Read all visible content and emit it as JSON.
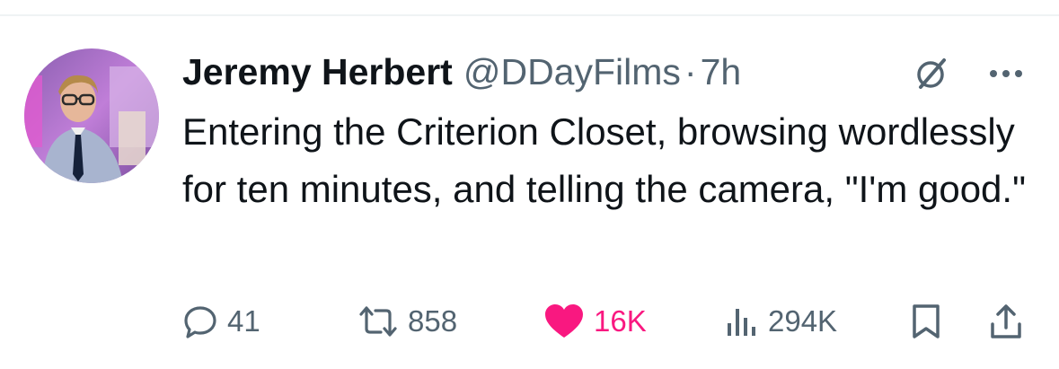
{
  "tweet": {
    "author": {
      "display_name": "Jeremy Herbert",
      "handle": "@DDayFilms"
    },
    "separator": "·",
    "time": "7h",
    "text": "Entering the Criterion Closet, browsing wordlessly for ten minutes, and telling the camera, \"I'm good.\"",
    "actions": {
      "replies": "41",
      "reposts": "858",
      "likes": "16K",
      "views": "294K"
    }
  },
  "icons": {
    "header": [
      "grok-icon",
      "more-icon"
    ],
    "actions": [
      "reply-icon",
      "repost-icon",
      "like-icon",
      "views-icon",
      "bookmark-icon",
      "share-icon"
    ]
  },
  "colors": {
    "text_primary": "#0f1419",
    "text_secondary": "#536471",
    "like_active": "#f91880",
    "divider": "#eff3f4"
  }
}
